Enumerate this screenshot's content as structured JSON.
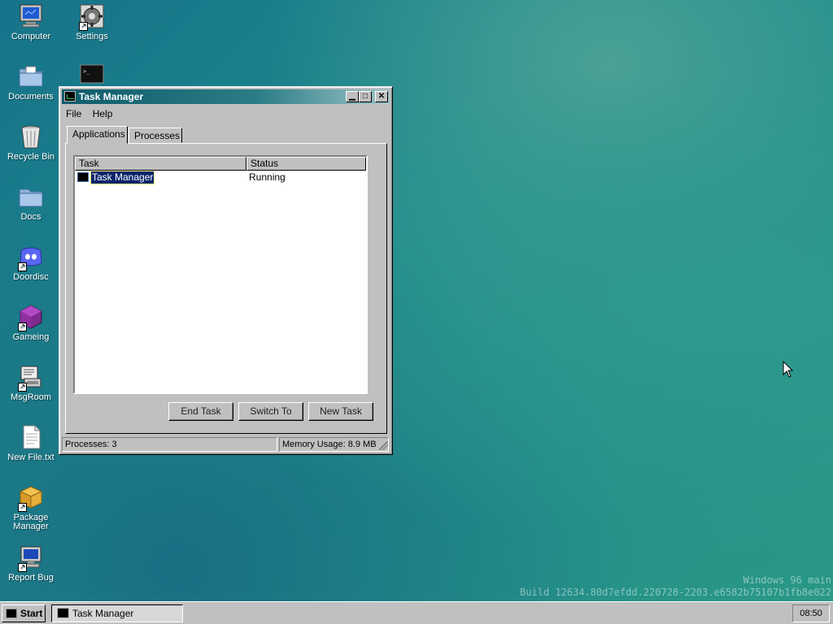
{
  "desktop": {
    "icons": [
      {
        "label": "Computer",
        "icon": "computer-icon"
      },
      {
        "label": "Settings",
        "icon": "settings-icon"
      },
      {
        "label": "Documents",
        "icon": "documents-folder-icon"
      },
      {
        "label": "Recycle Bin",
        "icon": "recycle-bin-icon"
      },
      {
        "label": "Docs",
        "icon": "folder-icon"
      },
      {
        "label": "Doordisc",
        "icon": "doordisc-icon"
      },
      {
        "label": "Gameing",
        "icon": "game-cube-icon"
      },
      {
        "label": "MsgRoom",
        "icon": "msgroom-icon"
      },
      {
        "label": "New File.txt",
        "icon": "text-file-icon"
      },
      {
        "label": "Package Manager",
        "icon": "package-icon"
      },
      {
        "label": "Report Bug",
        "icon": "report-bug-icon"
      },
      {
        "label": "",
        "icon": "terminal-icon"
      }
    ],
    "watermark_line1": "Windows 96 main",
    "watermark_line2": "Build 12634.80d7efdd.220728-2203.e6582b75107b1fb8e022"
  },
  "window": {
    "title": "Task Manager",
    "menu": [
      "File",
      "Help"
    ],
    "tabs": [
      "Applications",
      "Processes"
    ],
    "active_tab": "Applications",
    "columns": [
      "Task",
      "Status"
    ],
    "rows": [
      {
        "task": "Task Manager",
        "status": "Running"
      }
    ],
    "buttons": {
      "end_task": "End Task",
      "switch_to": "Switch To",
      "new_task": "New Task"
    },
    "status": {
      "processes": "Processes: 3",
      "memory": "Memory Usage: 8.9 MB"
    }
  },
  "taskbar": {
    "start_label": "Start",
    "items": [
      {
        "label": "Task Manager"
      }
    ],
    "clock": "08:50"
  },
  "colors": {
    "titlebar_start": "#0f5b6b",
    "selection": "#0a246a",
    "desktop": "#1d7e8a"
  }
}
